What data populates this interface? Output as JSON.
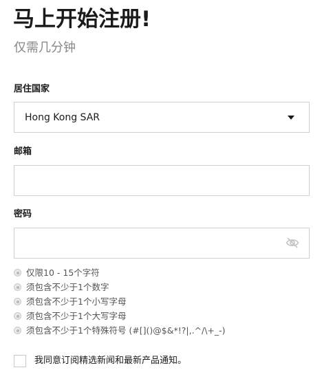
{
  "header": {
    "title": "马上开始注册!",
    "subtitle": "仅需几分钟"
  },
  "form": {
    "country": {
      "label": "居住国家",
      "value": "Hong Kong SAR",
      "icon": "chevron-down-icon"
    },
    "email": {
      "label": "邮箱",
      "value": "",
      "placeholder": ""
    },
    "password": {
      "label": "密码",
      "value": "",
      "placeholder": "",
      "icon": "eye-slash-icon"
    },
    "password_rules": [
      {
        "text": "仅限10 - 15个字符"
      },
      {
        "text": "须包含不少于1个数字"
      },
      {
        "text": "须包含不少于1个小写字母"
      },
      {
        "text": "须包含不少于1个大写字母"
      },
      {
        "text": "须包含不少于1个特殊符号 (#[]()@$&*!?|,.^/\\+_-)"
      }
    ],
    "newsletter_consent": {
      "checked": false,
      "label": "我同意订阅精选新闻和最新产品通知。"
    }
  },
  "colors": {
    "text": "#1a1a1a",
    "muted": "#888888",
    "border": "#cfcfcf",
    "rule_text": "#555555"
  }
}
